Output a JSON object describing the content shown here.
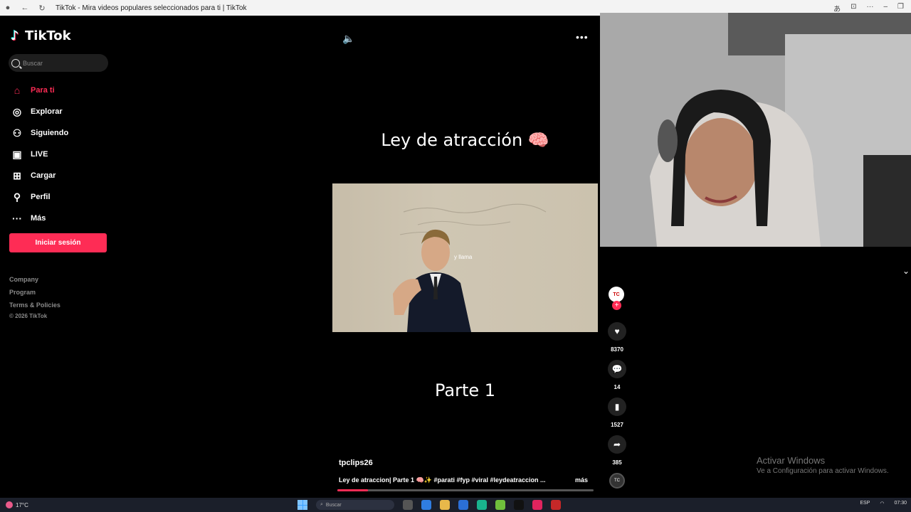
{
  "browser": {
    "tab_title": "TikTok - Mira videos populares seleccionados para ti | TikTok"
  },
  "sidebar": {
    "logo_text": "TikTok",
    "search_placeholder": "Buscar",
    "items": [
      {
        "label": "Para ti",
        "icon": "home-icon",
        "active": true
      },
      {
        "label": "Explorar",
        "icon": "compass-icon",
        "active": false
      },
      {
        "label": "Siguiendo",
        "icon": "following-icon",
        "active": false
      },
      {
        "label": "LIVE",
        "icon": "live-icon",
        "active": false
      },
      {
        "label": "Cargar",
        "icon": "upload-icon",
        "active": false
      },
      {
        "label": "Perfil",
        "icon": "profile-icon",
        "active": false
      },
      {
        "label": "Más",
        "icon": "more-icon",
        "active": false
      }
    ],
    "login_label": "Iniciar sesión",
    "footer": [
      "Company",
      "Program",
      "Terms & Policies"
    ],
    "copyright": "© 2026 TikTok"
  },
  "video": {
    "title": "Ley de atracción 🧠",
    "caption_in_video": "y llama",
    "part_label": "Parte 1",
    "username": "tpclips26",
    "description": "Ley de atraccion| Parte 1 🧠✨ #parati #fyp #viral #leydeatraccion ...",
    "more_label": "más",
    "progress": 0.12,
    "author_avatar_text": "TC",
    "disc_text": "TC"
  },
  "actions": {
    "likes": "8370",
    "comments": "14",
    "saves": "1527",
    "shares": "385"
  },
  "watermark": {
    "line1": "Activar Windows",
    "line2": "Ve a Configuración para activar Windows."
  },
  "taskbar": {
    "temperature": "17°C",
    "search_placeholder": "Buscar",
    "language": "ESP",
    "time": "07:30"
  },
  "colors": {
    "accent": "#fe2c55",
    "background": "#000000"
  }
}
